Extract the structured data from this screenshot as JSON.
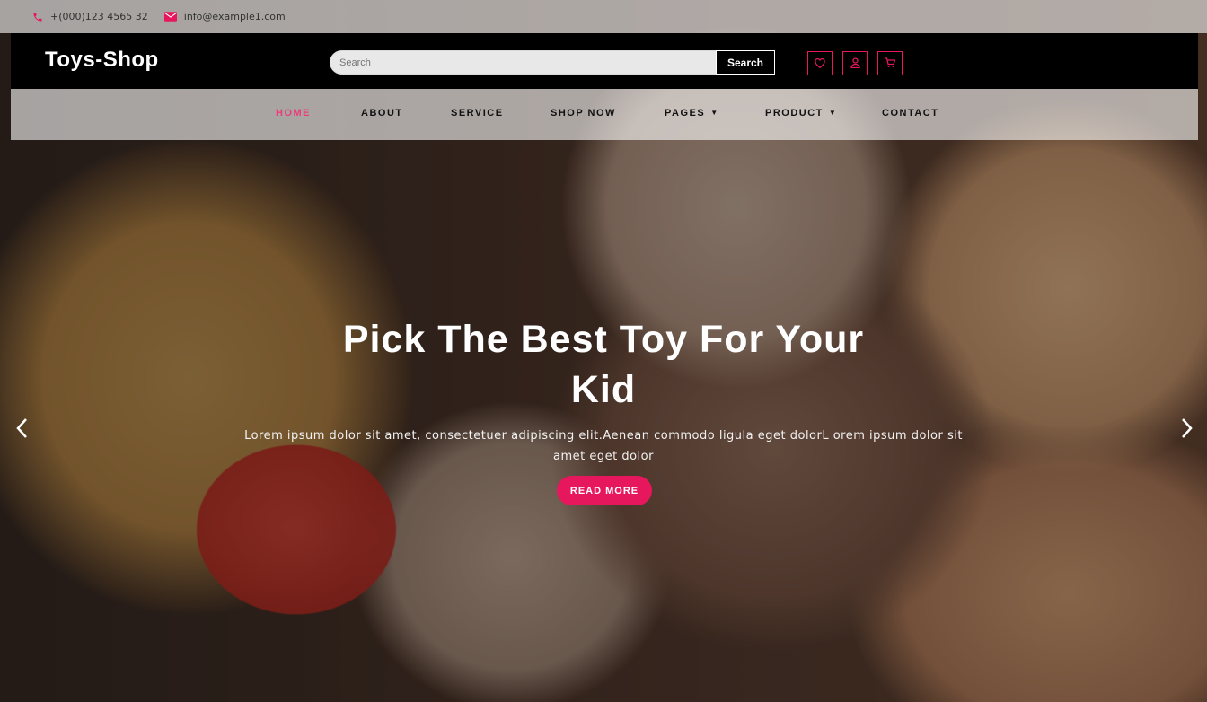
{
  "topbar": {
    "phone": "+(000)123 4565 32",
    "email": "info@example1.com",
    "phone_icon": "phone-icon",
    "email_icon": "envelope-icon"
  },
  "header": {
    "logo": "Toys-Shop",
    "search_placeholder": "Search",
    "search_button": "Search",
    "icons": [
      "heart-icon",
      "user-icon",
      "cart-icon"
    ]
  },
  "nav": {
    "items": [
      {
        "label": "HOME",
        "active": true
      },
      {
        "label": "ABOUT"
      },
      {
        "label": "SERVICE"
      },
      {
        "label": "SHOP NOW"
      },
      {
        "label": "PAGES",
        "dropdown": true
      },
      {
        "label": "PRODUCT",
        "dropdown": true
      },
      {
        "label": "CONTACT"
      }
    ]
  },
  "hero": {
    "title": "Pick The Best Toy For Your Kid",
    "text": "Lorem ipsum dolor sit amet, consectetuer adipiscing elit.Aenean commodo ligula eget dolorL orem ipsum dolor sit amet eget dolor",
    "button": "READ MORE",
    "prev_icon": "chevron-left-icon",
    "next_icon": "chevron-right-icon"
  },
  "colors": {
    "accent": "#e6175c",
    "nav_active": "#ea3d7a",
    "header_bg": "#000000"
  }
}
